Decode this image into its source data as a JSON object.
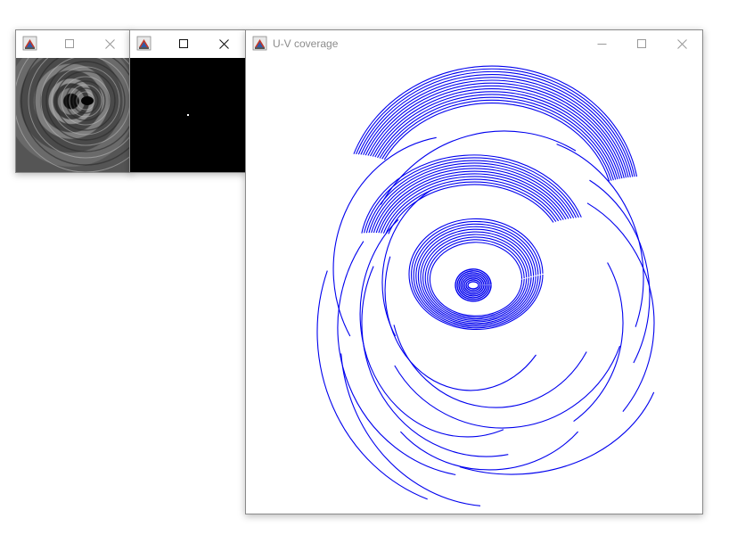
{
  "windows": {
    "image_window": {
      "title": "",
      "buttons": [
        "minimize",
        "maximize",
        "close"
      ]
    },
    "psf_window": {
      "title": "",
      "buttons": [
        "minimize",
        "maximize",
        "close"
      ]
    },
    "uv_window": {
      "title": "U-V coverage",
      "buttons": [
        "minimize",
        "maximize",
        "close"
      ]
    }
  },
  "icons": {
    "app_icon": "java-coffee-cup-icon",
    "minimize": "minimize-icon",
    "maximize": "maximize-icon",
    "close": "close-icon"
  },
  "colors": {
    "uv_track": "#0000ee",
    "psf_background": "#000000",
    "psf_dot": "#ffffff"
  }
}
